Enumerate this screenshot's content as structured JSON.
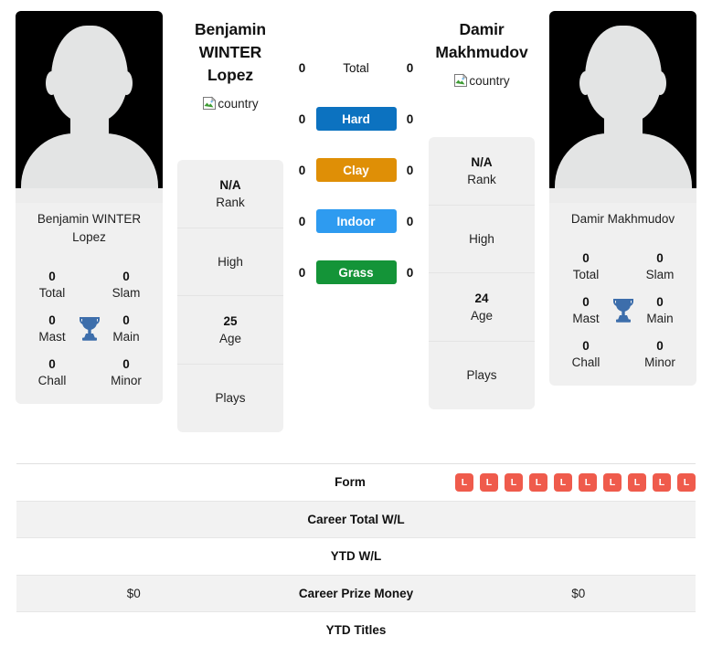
{
  "players": {
    "left": {
      "display_name": "Benjamin\nWINTER Lopez",
      "name_line1": "Benjamin",
      "name_line2": "WINTER Lopez",
      "country_alt": "country",
      "card_name": "Benjamin WINTER Lopez",
      "titles": {
        "total_value": "0",
        "total_label": "Total",
        "slam_value": "0",
        "slam_label": "Slam",
        "mast_value": "0",
        "mast_label": "Mast",
        "main_value": "0",
        "main_label": "Main",
        "chall_value": "0",
        "chall_label": "Chall",
        "minor_value": "0",
        "minor_label": "Minor"
      },
      "info": [
        {
          "value": "N/A",
          "label": "Rank"
        },
        {
          "value": "",
          "label": "High"
        },
        {
          "value": "25",
          "label": "Age"
        },
        {
          "value": "",
          "label": "Plays"
        }
      ],
      "career_prize_money": "$0",
      "career_total_wl": "",
      "ytd_wl": "",
      "ytd_titles": "",
      "form": []
    },
    "right": {
      "display_name": "Damir\nMakhmudov",
      "name_line1": "Damir",
      "name_line2": "Makhmudov",
      "country_alt": "country",
      "card_name": "Damir Makhmudov",
      "titles": {
        "total_value": "0",
        "total_label": "Total",
        "slam_value": "0",
        "slam_label": "Slam",
        "mast_value": "0",
        "mast_label": "Mast",
        "main_value": "0",
        "main_label": "Main",
        "chall_value": "0",
        "chall_label": "Chall",
        "minor_value": "0",
        "minor_label": "Minor"
      },
      "info": [
        {
          "value": "N/A",
          "label": "Rank"
        },
        {
          "value": "",
          "label": "High"
        },
        {
          "value": "24",
          "label": "Age"
        },
        {
          "value": "",
          "label": "Plays"
        }
      ],
      "career_prize_money": "$0",
      "career_total_wl": "",
      "ytd_wl": "",
      "ytd_titles": "",
      "form": [
        "L",
        "L",
        "L",
        "L",
        "L",
        "L",
        "L",
        "L",
        "L",
        "L"
      ]
    }
  },
  "head_to_head": {
    "rows": [
      {
        "label": "Total",
        "left": "0",
        "right": "0",
        "color": "",
        "plain": true
      },
      {
        "label": "Hard",
        "left": "0",
        "right": "0",
        "color": "#0c72c0",
        "plain": false
      },
      {
        "label": "Clay",
        "left": "0",
        "right": "0",
        "color": "#df8f06",
        "plain": false
      },
      {
        "label": "Indoor",
        "left": "0",
        "right": "0",
        "color": "#2e9bf0",
        "plain": false
      },
      {
        "label": "Grass",
        "left": "0",
        "right": "0",
        "color": "#149438",
        "plain": false
      }
    ]
  },
  "stats_table": {
    "rows": [
      {
        "label": "Form",
        "left": "",
        "right": "",
        "type": "form"
      },
      {
        "label": "Career Total W/L",
        "left": "",
        "right": "",
        "type": "text"
      },
      {
        "label": "YTD W/L",
        "left": "",
        "right": "",
        "type": "text"
      },
      {
        "label": "Career Prize Money",
        "left": "$0",
        "right": "$0",
        "type": "text"
      },
      {
        "label": "YTD Titles",
        "left": "",
        "right": "",
        "type": "text"
      }
    ]
  },
  "colors": {
    "hard": "#0c72c0",
    "clay": "#df8f06",
    "indoor": "#2e9bf0",
    "grass": "#149438",
    "loss_badge": "#ef5b4c",
    "trophy": "#3d6eab",
    "card_bg": "#f0f0f0",
    "row_shade": "#f2f2f2"
  }
}
